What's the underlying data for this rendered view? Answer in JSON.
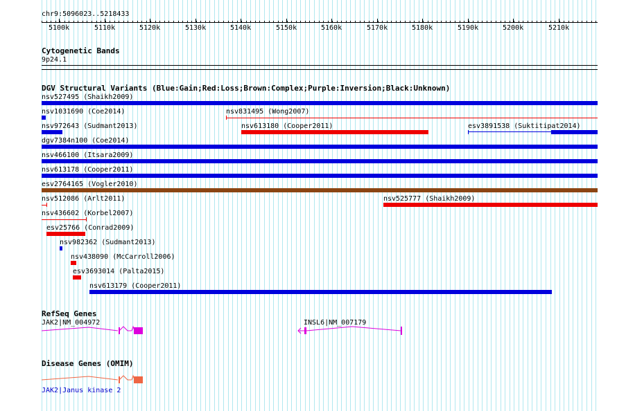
{
  "ruler": {
    "position": "chr9:5096023..5218433",
    "ticks": [
      "5100k",
      "5110k",
      "5120k",
      "5130k",
      "5140k",
      "5150k",
      "5160k",
      "5170k",
      "5180k",
      "5190k",
      "5200k",
      "5210k"
    ]
  },
  "tracks": {
    "cytobands": {
      "title": "Cytogenetic Bands",
      "band": "9p24.1"
    },
    "dgv": {
      "title": "DGV Structural Variants (Blue:Gain;Red:Loss;Brown:Complex;Purple:Inversion;Black:Unknown)",
      "variants": [
        "nsv527495 (Shaikh2009)",
        "nsv1031690 (Coe2014)",
        "nsv831495 (Wong2007)",
        "nsv972643 (Sudmant2013)",
        "nsv613180 (Cooper2011)",
        "esv3891538 (Suktitipat2014)",
        "dgv7384n100 (Coe2014)",
        "nsv466100 (Itsara2009)",
        "nsv613178 (Cooper2011)",
        "esv2764165 (Vogler2010)",
        "nsv512086 (Arlt2011)",
        "nsv525777 (Shaikh2009)",
        "nsv436602 (Korbel2007)",
        "esv25766 (Conrad2009)",
        "nsv982362 (Sudmant2013)",
        "nsv438090 (McCarroll2006)",
        "esv3693014 (Palta2015)",
        "nsv613179 (Cooper2011)"
      ]
    },
    "refseq": {
      "title": "RefSeq Genes",
      "genes": [
        "JAK2|NM_004972",
        "INSL6|NM_007179"
      ]
    },
    "omim": {
      "title": "Disease Genes (OMIM)",
      "gene": "JAK2|Janus kinase 2"
    }
  },
  "colors": {
    "grid": "#b0e8ef",
    "gain": "#0000dd",
    "loss": "#ee0000",
    "complex": "#8b4513",
    "gene": "#dd00dd",
    "omim": "#ee6644"
  }
}
